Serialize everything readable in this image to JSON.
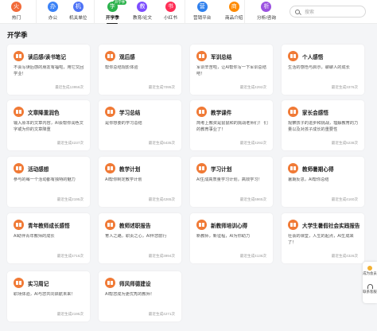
{
  "nav": {
    "items": [
      {
        "label": "热门",
        "icon": "fire-icon",
        "color": "#f26b3a",
        "glyph": "火"
      },
      {
        "label": "办公",
        "icon": "briefcase-icon",
        "color": "#3b82f6",
        "glyph": "办"
      },
      {
        "label": "机关单位",
        "icon": "building-icon",
        "color": "#4f74f6",
        "glyph": "机"
      },
      {
        "label": "开学季",
        "icon": "school-icon",
        "color": "#2bb24c",
        "glyph": "学",
        "badge": "开学季"
      },
      {
        "label": "教育/论文",
        "icon": "graduation-cap-icon",
        "color": "#7c4dff",
        "glyph": "教"
      },
      {
        "label": "小红书",
        "icon": "book-icon",
        "color": "#ff2d55",
        "glyph": "书"
      },
      {
        "label": "营销平台",
        "icon": "megaphone-icon",
        "color": "#2f80ed",
        "glyph": "营"
      },
      {
        "label": "商品介绍",
        "icon": "shopping-bag-icon",
        "color": "#ff8a00",
        "glyph": "商"
      },
      {
        "label": "分析/咨询",
        "icon": "chart-icon",
        "color": "#9b51e0",
        "glyph": "析"
      }
    ],
    "active_index": 3,
    "search_placeholder": "搜索"
  },
  "section": {
    "title": "开学季"
  },
  "cards": [
    {
      "title": "读后感/读书笔记",
      "desc": "不会写读后感的朋友有福啦，用它又回学业！",
      "count": "最近生成13956次"
    },
    {
      "title": "观后感",
      "desc": "帮你总结观影体验",
      "count": "最近生成7095次"
    },
    {
      "title": "军训总结",
      "desc": "军训辛苦啦，让AI帮你写一下军训总结吧！",
      "count": "最近生成4292次"
    },
    {
      "title": "个人感悟",
      "desc": "生活的感悟与启示，聊聊人的成长",
      "count": "最近生成3376次"
    },
    {
      "title": "文章降重润色",
      "desc": "输入原本的文章内容，AI会帮你润色文字或为你的文章降重",
      "count": "最近生成4237次"
    },
    {
      "title": "学习总结",
      "desc": "是你想要的学习总结",
      "count": "最近生成6435次"
    },
    {
      "title": "教学课件",
      "desc": "简考上教资是鼠鼠和的挑战老师们！ 们的教育事业了！",
      "count": "最近生成4292次"
    },
    {
      "title": "家长会感悟",
      "desc": "观察孩子的进步和挑战，理解教育的力量以及对孩子成长的重要性",
      "count": "最近生成5238次"
    },
    {
      "title": "活动感想",
      "desc": "参与的每一个活动都有独特的魅力",
      "count": "最近生成2195次"
    },
    {
      "title": "教学计划",
      "desc": "AI帮你制定教学计划",
      "count": "最近生成4265次"
    },
    {
      "title": "学习计划",
      "desc": "AI生成高质量学习计划，高效学习！",
      "count": "最近生成6965次"
    },
    {
      "title": "教师暑期心得",
      "desc": "暑期反思，AI帮你总结",
      "count": "最近生成4160次"
    },
    {
      "title": "青年教师成长感悟",
      "desc": "AI助伴青年教师的成长",
      "count": "最近生成4716次"
    },
    {
      "title": "教师述职报告",
      "desc": "育人之路，职责之心，AI伴您前行",
      "count": "最近生成3994次"
    },
    {
      "title": "新教师培训心得",
      "desc": "新教师，新征程，AI为你助力",
      "count": "最近生成4136次"
    },
    {
      "title": "大学生暑假社会实践报告",
      "desc": "社会的课堂，人生的起点，AI生成来了！",
      "count": "最近生成4326次"
    },
    {
      "title": "实习周记",
      "desc": "职场体验，AI与您共同启航未来！",
      "count": "最近生成2195次"
    },
    {
      "title": "师风师德建设",
      "desc": "AI帮您成为更优秀的教师！",
      "count": "最近生成4271次"
    }
  ],
  "float_widget": {
    "items": [
      {
        "label": "成为会员",
        "icon": "coin-icon"
      },
      {
        "label": "联系客服",
        "icon": "headset-icon"
      }
    ]
  }
}
